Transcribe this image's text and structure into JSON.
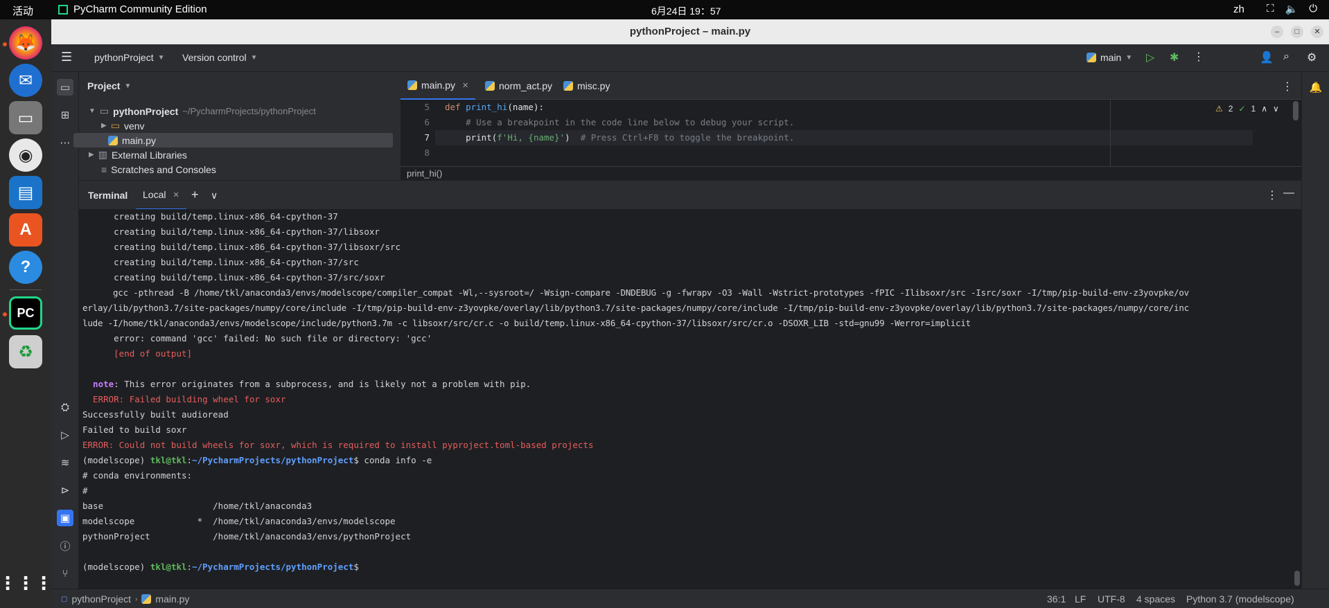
{
  "topbar": {
    "activities": "活动",
    "app_name": "PyCharm Community Edition",
    "clock": "6月24日  19：57",
    "lang": "zh"
  },
  "window": {
    "title": "pythonProject – main.py"
  },
  "mainbar": {
    "project": "pythonProject",
    "vcs": "Version control",
    "run_config": "main"
  },
  "project_panel": {
    "header": "Project",
    "root": "pythonProject",
    "root_path": "~/PycharmProjects/pythonProject",
    "venv": "venv",
    "main_file": "main.py",
    "external": "External Libraries",
    "scratches": "Scratches and Consoles"
  },
  "editor": {
    "tabs": [
      {
        "label": "main.py"
      },
      {
        "label": "norm_act.py"
      },
      {
        "label": "misc.py"
      }
    ],
    "line_numbers": [
      "5",
      "6",
      "7",
      "8"
    ],
    "lines": {
      "l5_kw": "def",
      "l5_fn": "print_hi",
      "l5_rest": "(name):",
      "l6": "    # Use a breakpoint in the code line below to debug your script.",
      "l7_a": "    print(",
      "l7_str": "f'Hi, {name}'",
      "l7_b": ")",
      "l7_cm": "  # Press Ctrl+F8 to toggle the breakpoint."
    },
    "inspections": {
      "warnings": "2",
      "ok": "1"
    },
    "breadcrumb": "print_hi()"
  },
  "terminal": {
    "title": "Terminal",
    "tab": "Local",
    "lines": [
      "      creating build/temp.linux-x86_64-cpython-37",
      "      creating build/temp.linux-x86_64-cpython-37/libsoxr",
      "      creating build/temp.linux-x86_64-cpython-37/libsoxr/src",
      "      creating build/temp.linux-x86_64-cpython-37/src",
      "      creating build/temp.linux-x86_64-cpython-37/src/soxr",
      "      gcc -pthread -B /home/tkl/anaconda3/envs/modelscope/compiler_compat -Wl,--sysroot=/ -Wsign-compare -DNDEBUG -g -fwrapv -O3 -Wall -Wstrict-prototypes -fPIC -Ilibsoxr/src -Isrc/soxr -I/tmp/pip-build-env-z3yovpke/ov",
      "erlay/lib/python3.7/site-packages/numpy/core/include -I/tmp/pip-build-env-z3yovpke/overlay/lib/python3.7/site-packages/numpy/core/include -I/tmp/pip-build-env-z3yovpke/overlay/lib/python3.7/site-packages/numpy/core/inc",
      "lude -I/home/tkl/anaconda3/envs/modelscope/include/python3.7m -c libsoxr/src/cr.c -o build/temp.linux-x86_64-cpython-37/libsoxr/src/cr.o -DSOXR_LIB -std=gnu99 -Werror=implicit",
      "      error: command 'gcc' failed: No such file or directory: 'gcc'"
    ],
    "end_output": "      [end of output]",
    "note_label": "  note",
    "note_text": ": This error originates from a subprocess, and is likely not a problem with pip.",
    "error_wheel": "  ERROR: Failed building wheel for soxr",
    "built": "Successfully built audioread",
    "failed": "Failed to build soxr",
    "error_final": "ERROR: Could not build wheels for soxr, which is required to install pyproject.toml-based projects",
    "prompt_env": "(modelscope) ",
    "prompt_user": "tkl@tkl",
    "prompt_colon": ":",
    "prompt_path": "~/PycharmProjects/pythonProject",
    "prompt_dollar": "$",
    "command": " conda info -e",
    "env_header1": "# conda environments:",
    "env_header2": "#",
    "envs": [
      "base                     /home/tkl/anaconda3",
      "modelscope            *  /home/tkl/anaconda3/envs/modelscope",
      "pythonProject            /home/tkl/anaconda3/envs/pythonProject"
    ]
  },
  "statusbar": {
    "project": "pythonProject",
    "file": "main.py",
    "position": "36:1",
    "line_sep": "LF",
    "encoding": "UTF-8",
    "indent": "4 spaces",
    "interpreter": "Python 3.7 (modelscope)"
  },
  "colors": {
    "accent": "#3574f0",
    "error": "#e55e5e",
    "dock": "#2b2b2b"
  }
}
